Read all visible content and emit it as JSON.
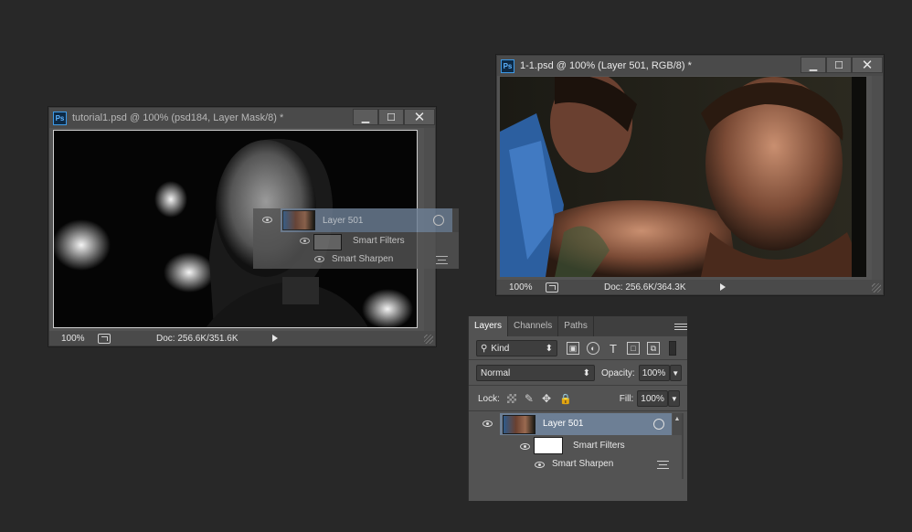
{
  "colors": {
    "desktop": "#282828",
    "panel_bg": "#535353",
    "selected_layer": "#6d7f95",
    "ps_icon_border": "#3d9ae8"
  },
  "window_left": {
    "icon": "Ps",
    "title": "tutorial1.psd @ 100% (psd184, Layer Mask/8) *",
    "zoom": "100%",
    "doc_info": "Doc: 256.6K/351.6K"
  },
  "window_right": {
    "icon": "Ps",
    "title": "1-1.psd @ 100% (Layer 501, RGB/8) *",
    "zoom": "100%",
    "doc_info": "Doc: 256.6K/364.3K"
  },
  "window_buttons": {
    "minimize": "▁",
    "maximize": "☐",
    "close": "✕"
  },
  "drag_ghost": {
    "layer_name": "Layer 501",
    "smart_filters": "Smart Filters",
    "filter_name": "Smart Sharpen"
  },
  "layers_panel": {
    "tabs": [
      "Layers",
      "Channels",
      "Paths"
    ],
    "active_tab": "Layers",
    "filter_kind": "Kind",
    "blend_mode": "Normal",
    "opacity_label": "Opacity:",
    "opacity_value": "100%",
    "lock_label": "Lock:",
    "fill_label": "Fill:",
    "fill_value": "100%",
    "filter_icons": [
      "image-filter-icon",
      "adjustment-filter-icon",
      "type-filter-icon",
      "shape-filter-icon",
      "smart-object-filter-icon"
    ],
    "layers": [
      {
        "name": "Layer 501",
        "selected": true,
        "visible": true,
        "smart_object": true
      },
      {
        "name": "Smart Filters",
        "visible": true
      },
      {
        "name": "Smart Sharpen",
        "visible": true
      }
    ]
  }
}
